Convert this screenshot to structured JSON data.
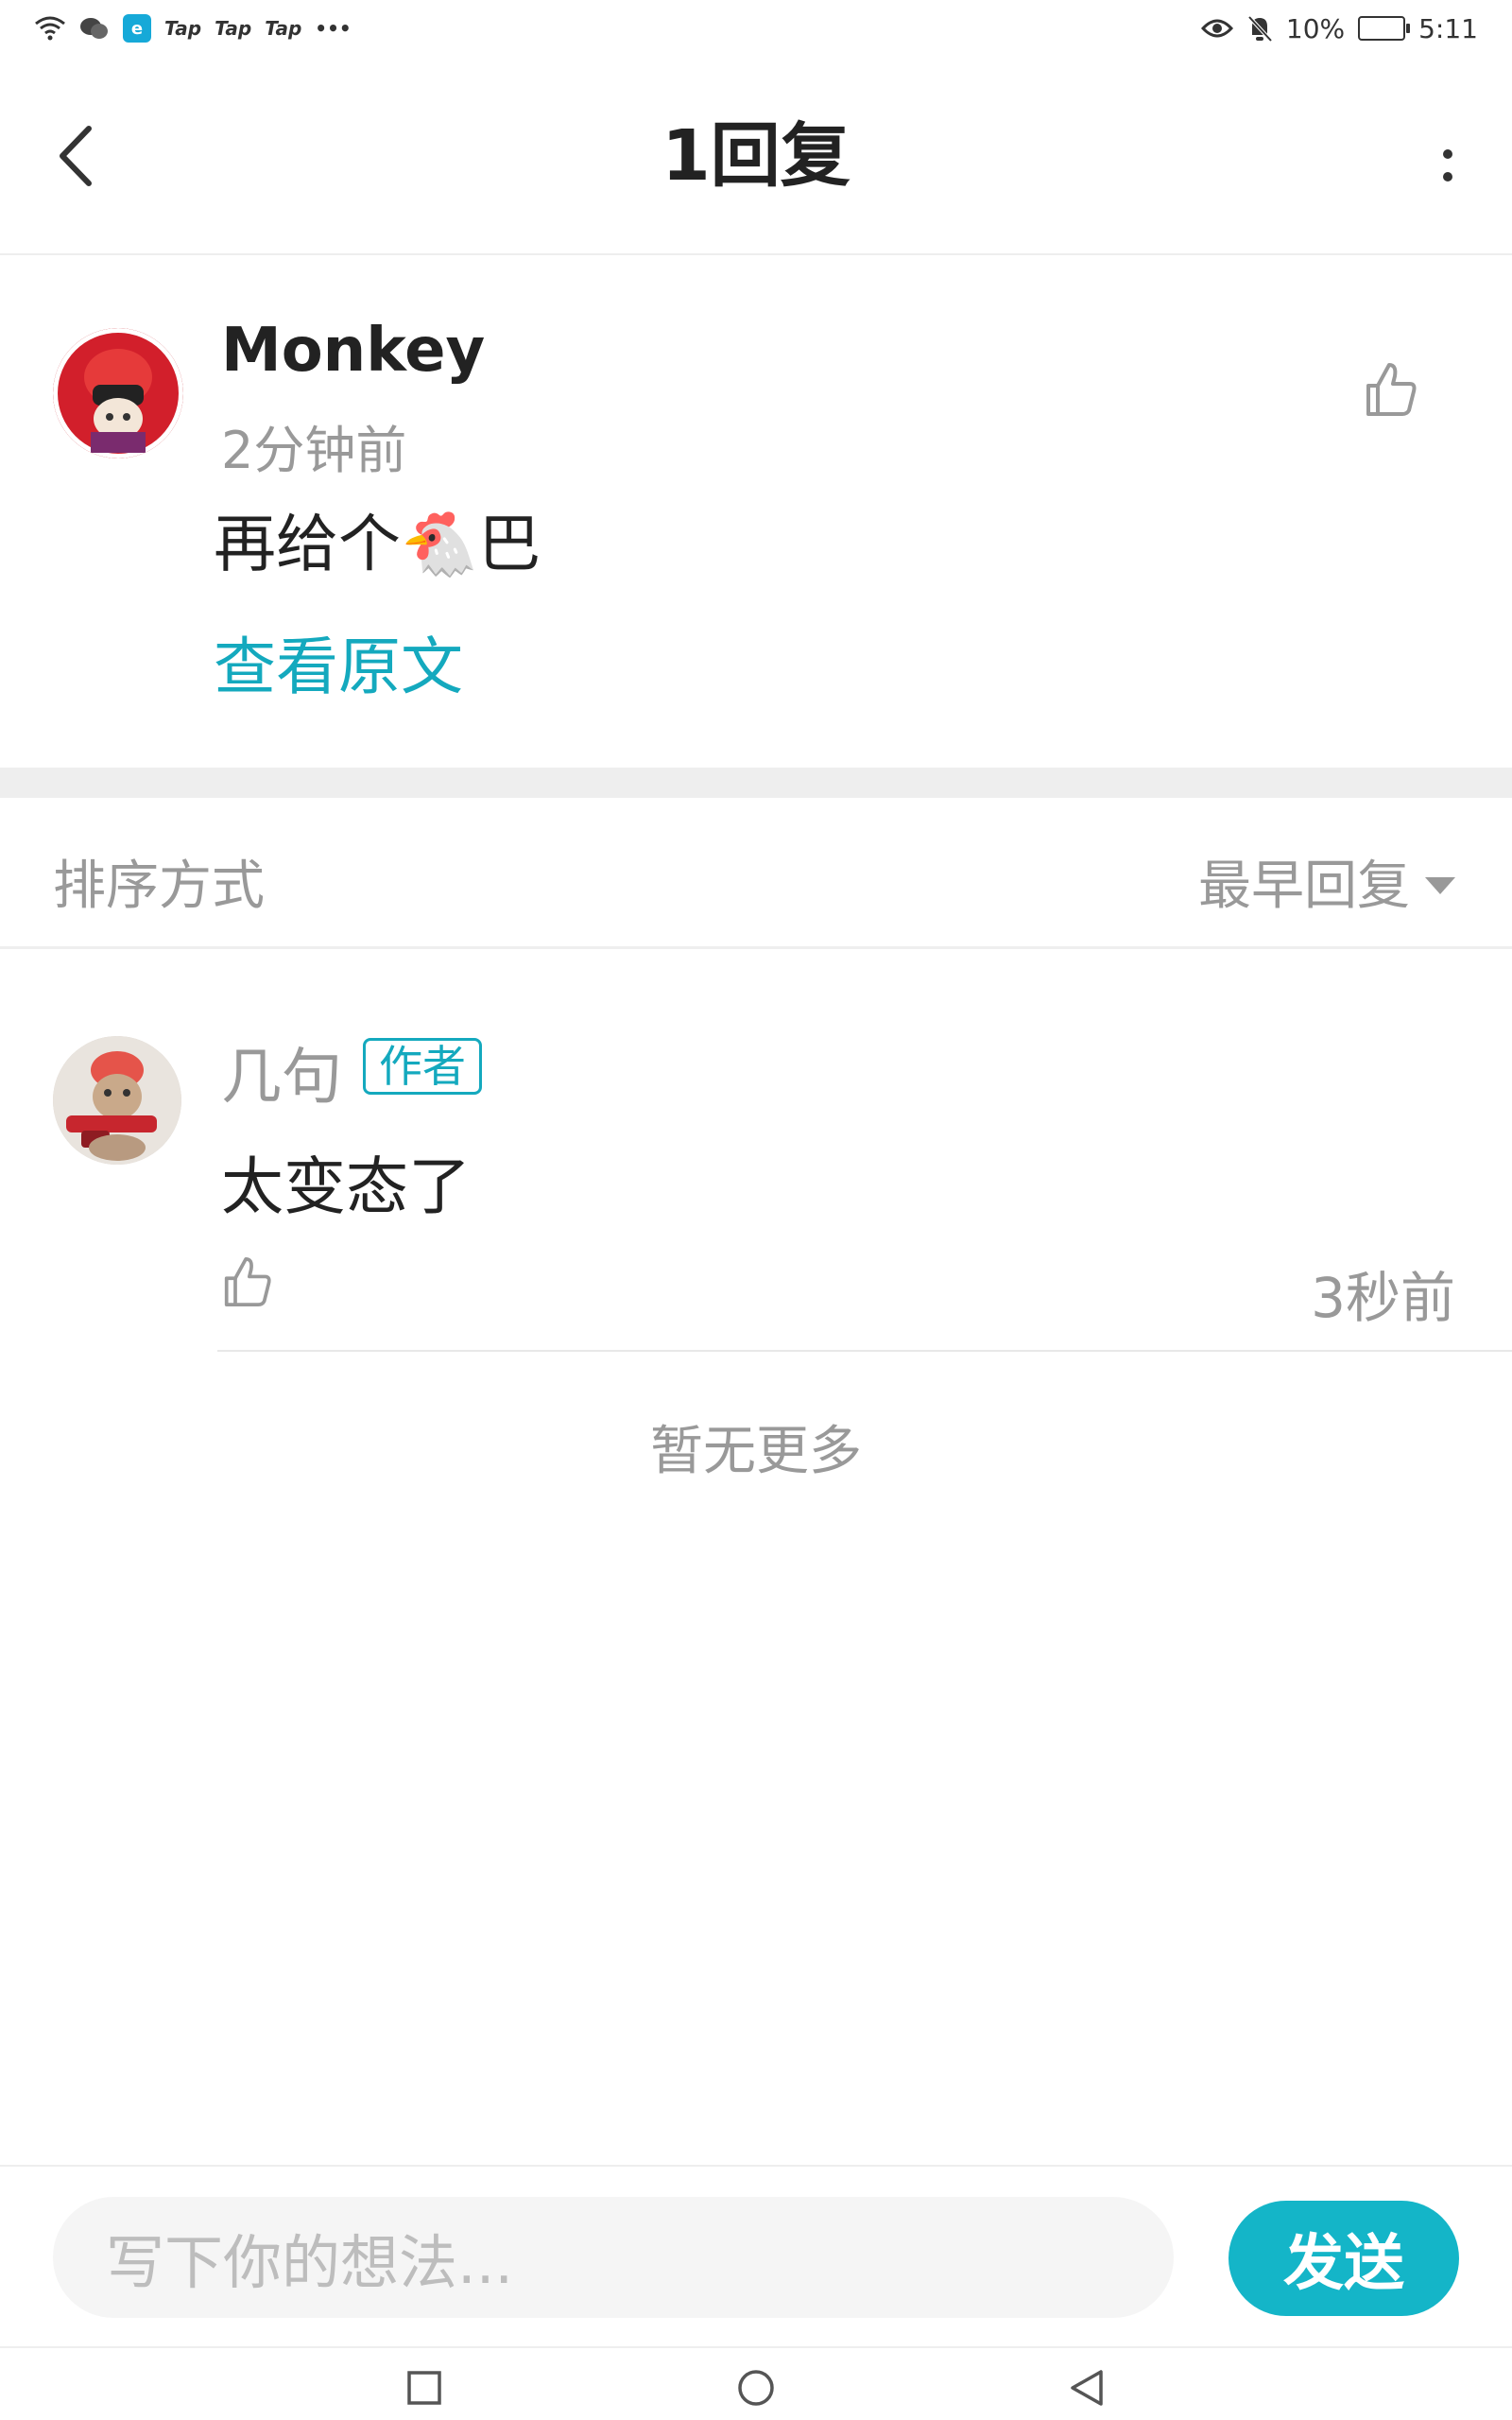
{
  "status_bar": {
    "notification_texts": [
      "Tap",
      "Tap",
      "Tap"
    ],
    "more": "•••",
    "battery": "10%",
    "time": "5:11"
  },
  "header": {
    "title": "1回复",
    "back_icon": "chevron-left-icon",
    "more_icon": "vertical-dots-icon"
  },
  "post": {
    "author": "Monkey",
    "time": "2分钟前",
    "content": "再给个🐔巴",
    "view_original": "查看原文",
    "like_icon": "thumbs-up-icon"
  },
  "sort": {
    "label": "排序方式",
    "value": "最早回复"
  },
  "replies": [
    {
      "author": "几句",
      "badge": "作者",
      "content": "太变态了",
      "time": "3秒前"
    }
  ],
  "footer_note": "暂无更多",
  "composer": {
    "placeholder": "写下你的想法...",
    "send_label": "发送"
  },
  "colors": {
    "accent": "#14a9be",
    "send_button": "#14b5c8",
    "muted_text": "#999999"
  }
}
